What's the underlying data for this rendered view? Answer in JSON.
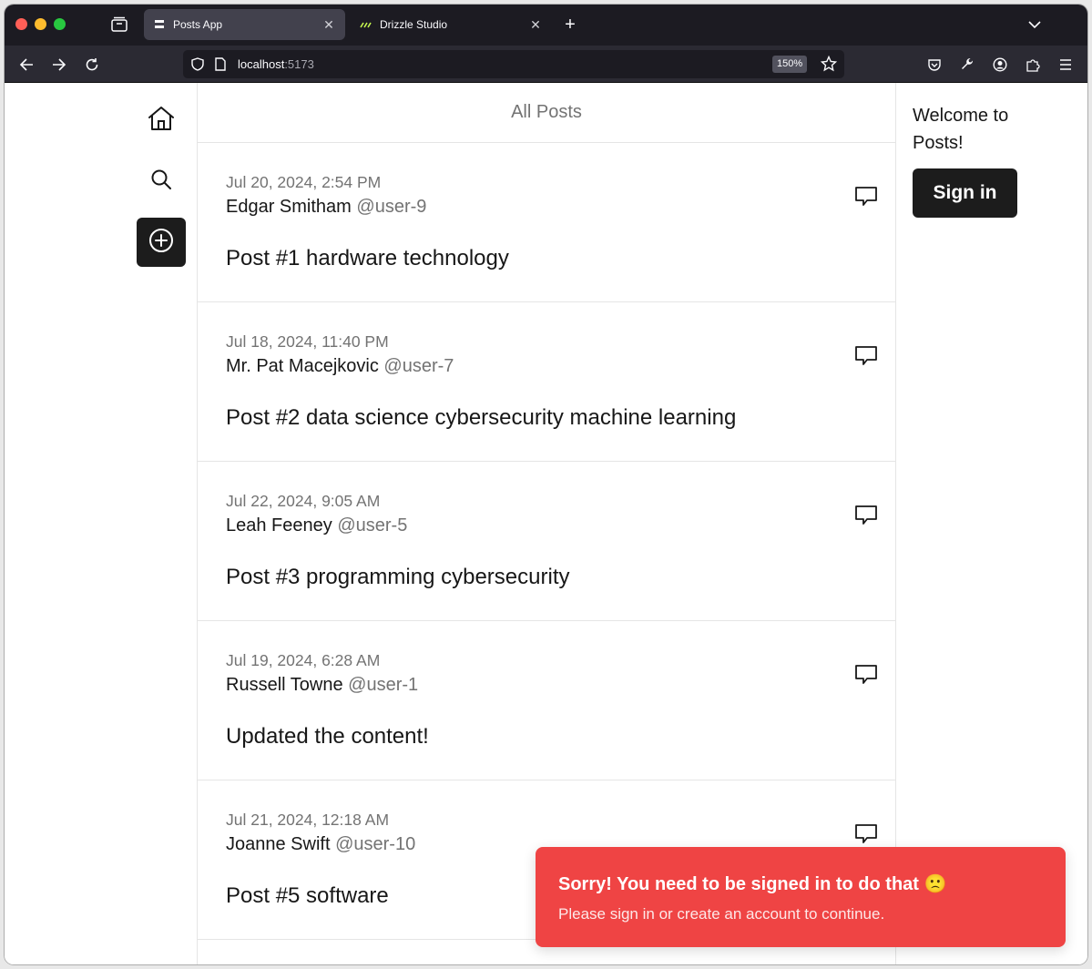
{
  "browser": {
    "tabs": [
      {
        "title": "Posts App",
        "active": true,
        "favicon": "page-lines-icon"
      },
      {
        "title": "Drizzle Studio",
        "active": false,
        "favicon": "drizzle-logo-icon"
      }
    ],
    "url": {
      "host": "localhost",
      "port": ":5173"
    },
    "zoom": "150%",
    "colors": {
      "chrome": "#1c1b22",
      "toolbar": "#2b2a33",
      "active_tab": "#42414d"
    }
  },
  "left_nav": {
    "items": [
      {
        "icon": "home-icon"
      },
      {
        "icon": "search-icon"
      },
      {
        "icon": "plus-circle-icon"
      }
    ]
  },
  "feed": {
    "title": "All Posts",
    "posts": [
      {
        "date": "Jul 20, 2024, 2:54 PM",
        "author": "Edgar Smitham",
        "handle": "@user-9",
        "content": "Post #1 hardware technology"
      },
      {
        "date": "Jul 18, 2024, 11:40 PM",
        "author": "Mr. Pat Macejkovic",
        "handle": "@user-7",
        "content": "Post #2 data science cybersecurity machine learning"
      },
      {
        "date": "Jul 22, 2024, 9:05 AM",
        "author": "Leah Feeney",
        "handle": "@user-5",
        "content": "Post #3 programming cybersecurity"
      },
      {
        "date": "Jul 19, 2024, 6:28 AM",
        "author": "Russell Towne",
        "handle": "@user-1",
        "content": "Updated the content!"
      },
      {
        "date": "Jul 21, 2024, 12:18 AM",
        "author": "Joanne Swift",
        "handle": "@user-10",
        "content": "Post #5 software"
      }
    ]
  },
  "sidebar_right": {
    "welcome": "Welcome to Posts!",
    "signin_label": "Sign in"
  },
  "toast": {
    "title": "Sorry! You need to be signed in to do that 🙁",
    "description": "Please sign in or create an account to continue.",
    "color": "#ef4444"
  }
}
